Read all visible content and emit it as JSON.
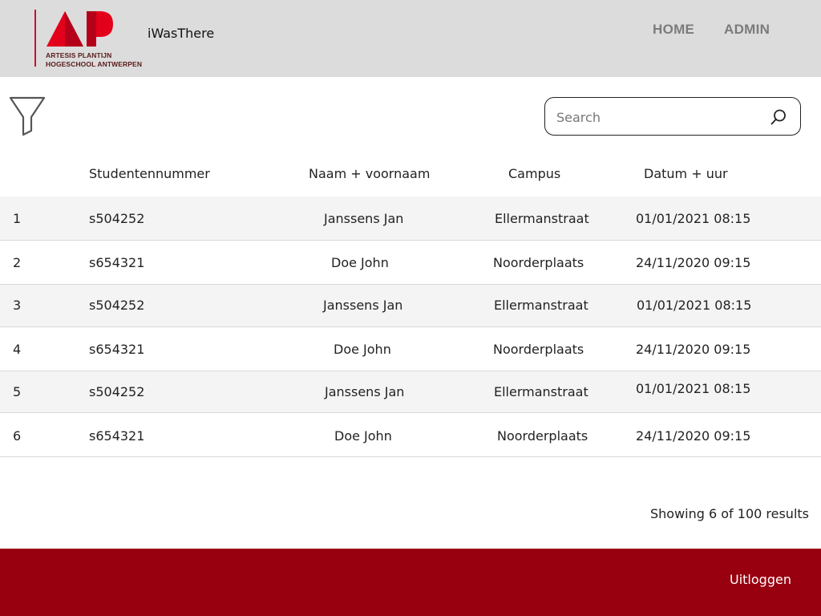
{
  "header": {
    "logo_lines": [
      "ARTESIS PLANTIJN",
      "HOGESCHOOL ANTWERPEN"
    ],
    "app_name": "iWasThere",
    "nav": [
      {
        "label": "HOME"
      },
      {
        "label": "ADMIN"
      }
    ]
  },
  "toolbar": {
    "filter_icon": "funnel-icon",
    "search_placeholder": "Search",
    "search_icon": "magnifier-icon"
  },
  "table": {
    "columns": [
      "Studentennummer",
      "Naam + voornaam",
      "Campus",
      "Datum + uur"
    ],
    "rows": [
      {
        "index": "1",
        "student": "s504252",
        "name": "Janssens Jan",
        "campus": "Ellermanstraat",
        "datetime": "01/01/2021 08:15"
      },
      {
        "index": "2",
        "student": "s654321",
        "name": "Doe John",
        "campus": "Noorderplaats",
        "datetime": "24/11/2020 09:15"
      },
      {
        "index": "3",
        "student": "s504252",
        "name": "Janssens Jan",
        "campus": "Ellermanstraat",
        "datetime": "01/01/2021 08:15"
      },
      {
        "index": "4",
        "student": "s654321",
        "name": "Doe John",
        "campus": "Noorderplaats",
        "datetime": "24/11/2020 09:15"
      },
      {
        "index": "5",
        "student": "s504252",
        "name": "Janssens Jan",
        "campus": "Ellermanstraat",
        "datetime": "01/01/2021 08:15"
      },
      {
        "index": "6",
        "student": "s654321",
        "name": "Doe John",
        "campus": "Noorderplaats",
        "datetime": "24/11/2020 09:15"
      }
    ]
  },
  "results_text": "Showing 6 of 100 results",
  "footer": {
    "logout_label": "Uitloggen"
  },
  "colors": {
    "header_bg": "#dcdcdc",
    "footer_bg": "#99000f",
    "brand_red": "#c8102e",
    "row_alt_bg": "#f4f4f4"
  }
}
